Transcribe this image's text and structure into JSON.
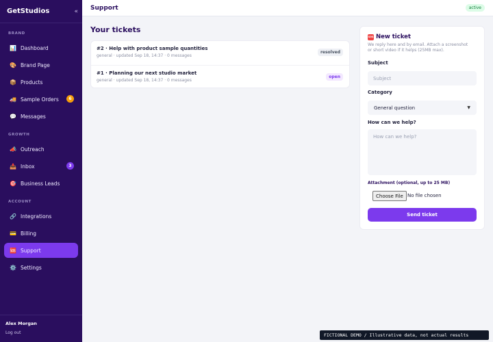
{
  "sidebar": {
    "brand": "GetStudios",
    "collapse_icon": "«",
    "sections": {
      "brand": "BRAND",
      "growth": "GROWTH",
      "account": "ACCOUNT"
    },
    "items": [
      {
        "label": "Dashboard",
        "icon": "📊"
      },
      {
        "label": "Brand Page",
        "icon": "🎨"
      },
      {
        "label": "Products",
        "icon": "📦"
      },
      {
        "label": "Sample Orders",
        "icon": "🚚",
        "badge": "6"
      },
      {
        "label": "Messages",
        "icon": "💬"
      },
      {
        "label": "Outreach",
        "icon": "📣"
      },
      {
        "label": "Inbox",
        "icon": "📥",
        "badge": "3"
      },
      {
        "label": "Business Leads",
        "icon": "🎯"
      },
      {
        "label": "Integrations",
        "icon": "🔗"
      },
      {
        "label": "Billing",
        "icon": "💳"
      },
      {
        "label": "Support",
        "icon": "🆘"
      },
      {
        "label": "Settings",
        "icon": "⚙️"
      }
    ],
    "user": {
      "name": "Alex Morgan",
      "logout": "Log out"
    }
  },
  "header": {
    "title": "Support",
    "status": "active"
  },
  "tickets": {
    "title": "Your tickets",
    "rows": [
      {
        "title": "#2 · Help with product sample quantities",
        "meta": "general · updated Sep 18, 14:37 · 0 messages",
        "status": "resolved"
      },
      {
        "title": "#1 · Planning our next studio market",
        "meta": "general · updated Sep 18, 14:37 · 0 messages",
        "status": "open"
      }
    ]
  },
  "new_ticket": {
    "title": "New ticket",
    "subtitle": "We reply here and by email. Attach a screenshot or short video if it helps (25MB max).",
    "subject_label": "Subject",
    "subject_placeholder": "Subject",
    "category_label": "Category",
    "category_selected": "General question",
    "help_label": "How can we help?",
    "help_placeholder": "How can we help?",
    "attachment_label": "Attachment (optional, up to 25 MB)",
    "choose_file": "Choose File",
    "no_file": "No file chosen",
    "send_label": "Send ticket"
  },
  "demo_banner": "FICTIONAL DEMO  /  Illustrative data, not actual results"
}
